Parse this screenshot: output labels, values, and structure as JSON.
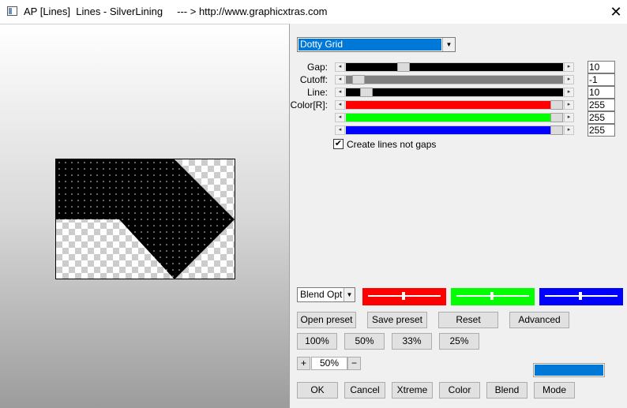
{
  "window": {
    "title": "AP [Lines]  Lines - SilverLining     --- > http://www.graphicxtras.com",
    "close_glyph": "✕",
    "icon": "app-window-icon"
  },
  "effect_select": {
    "value": "Dotty Grid"
  },
  "sliders": [
    {
      "label": "Gap:",
      "value": "10",
      "color": "#000000",
      "level": 0.25
    },
    {
      "label": "Cutoff:",
      "value": "-1",
      "color": "#808080",
      "level": 0.03
    },
    {
      "label": "Line:",
      "value": "10",
      "color": "#000000",
      "level": 0.07
    },
    {
      "label": "Color[R]:",
      "value": "255",
      "color": "#ff0000",
      "level": 1.0
    },
    {
      "label": "",
      "value": "255",
      "color": "#00ff00",
      "level": 1.0
    },
    {
      "label": "",
      "value": "255",
      "color": "#0000ff",
      "level": 1.0
    }
  ],
  "checkbox": {
    "label": "Create lines not gaps",
    "checked": true,
    "check_glyph": "✔"
  },
  "blend_select": {
    "value": "Blend Options"
  },
  "color_swatches": [
    {
      "color": "#ff0000"
    },
    {
      "color": "#00ff00"
    },
    {
      "color": "#0000ff"
    }
  ],
  "preset_buttons": {
    "open": "Open preset",
    "save": "Save preset",
    "reset": "Reset",
    "advanced": "Advanced"
  },
  "zoom_buttons": [
    "100%",
    "50%",
    "33%",
    "25%"
  ],
  "zoom": {
    "plus": "+",
    "value": "50%",
    "minus": "−"
  },
  "accent_color": "#0078d7",
  "bottom_buttons": {
    "ok": "OK",
    "cancel": "Cancel",
    "xtreme": "Xtreme",
    "color": "Color",
    "blend": "Blend",
    "mode": "Mode"
  }
}
